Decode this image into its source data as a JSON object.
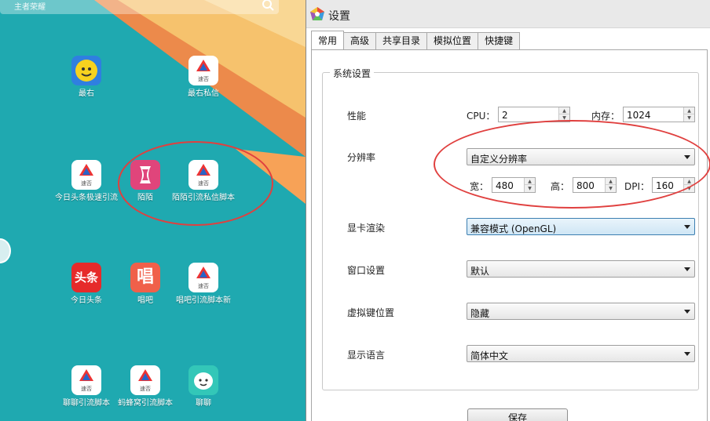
{
  "home": {
    "search_placeholder": "主者荣耀",
    "apps": [
      {
        "label": "最右"
      },
      {
        "label": "最右私信"
      },
      {
        "label": "今日头条极速引流"
      },
      {
        "label": "陌陌"
      },
      {
        "label": "陌陌引流私信脚本"
      },
      {
        "label": "今日头条"
      },
      {
        "label": "唱吧"
      },
      {
        "label": "唱吧引流脚本新"
      },
      {
        "label": "聊聊引流脚本"
      },
      {
        "label": "蚂蜂窝引流脚本"
      },
      {
        "label": "聊聊"
      }
    ],
    "sujia_icon_text": "速否",
    "toutiao_icon_text": "头条",
    "changba_icon_text": "唱"
  },
  "window": {
    "title": "设置",
    "tabs": [
      "常用",
      "高级",
      "共享目录",
      "模拟位置",
      "快捷键"
    ],
    "group_title": "系统设置",
    "performance": {
      "label": "性能",
      "cpu_label": "CPU：",
      "cpu_value": "2",
      "mem_label": "内存：",
      "mem_value": "1024"
    },
    "resolution": {
      "label": "分辨率",
      "preset": "自定义分辨率",
      "width_label": "宽：",
      "width": "480",
      "height_label": "高：",
      "height": "800",
      "dpi_label": "DPI：",
      "dpi": "160"
    },
    "gpu": {
      "label": "显卡渲染",
      "value": "兼容模式 (OpenGL)"
    },
    "window_setting": {
      "label": "窗口设置",
      "value": "默认"
    },
    "virtual_keys": {
      "label": "虚拟键位置",
      "value": "隐藏"
    },
    "language": {
      "label": "显示语言",
      "value": "简体中文"
    },
    "save_label": "保存"
  },
  "colors": {
    "android_bg": "#1fa9b0",
    "stripe_orange": "#ec8a4b",
    "stripe_light": "#f6c26d",
    "annotation_red": "#e0403f"
  }
}
